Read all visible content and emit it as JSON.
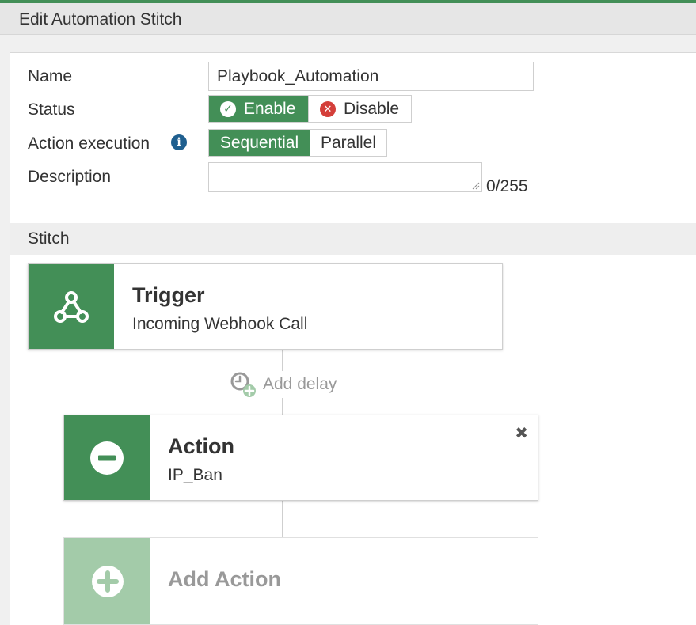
{
  "header": {
    "title": "Edit Automation Stitch"
  },
  "form": {
    "name_label": "Name",
    "name_value": "Playbook_Automation",
    "status_label": "Status",
    "status_enable": "Enable",
    "status_disable": "Disable",
    "status_selected": "Enable",
    "action_execution_label": "Action execution",
    "execution_sequential": "Sequential",
    "execution_parallel": "Parallel",
    "execution_selected": "Sequential",
    "description_label": "Description",
    "description_value": "",
    "description_counter": "0/255"
  },
  "stitch": {
    "section_label": "Stitch",
    "trigger": {
      "title": "Trigger",
      "subtitle": "Incoming Webhook Call",
      "icon": "webhook-icon"
    },
    "add_delay": "Add delay",
    "action": {
      "title": "Action",
      "subtitle": "IP_Ban",
      "icon": "minus-circle-icon"
    },
    "add_action": "Add Action"
  },
  "colors": {
    "accent": "#438f57",
    "accent_light": "#a3cba9",
    "danger": "#d43f3a",
    "info": "#1f5f8f"
  }
}
